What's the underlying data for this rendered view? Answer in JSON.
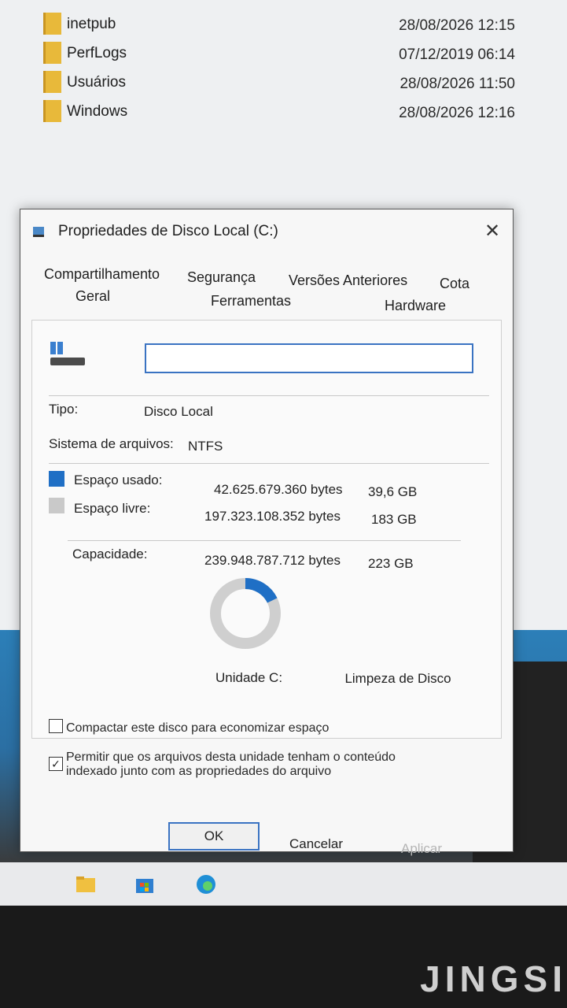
{
  "explorer": {
    "rows": [
      {
        "name": "inetpub",
        "date": "28/08/2026 12:15"
      },
      {
        "name": "PerfLogs",
        "date": "07/12/2019 06:14"
      },
      {
        "name": "Usuários",
        "date": "28/08/2026 11:50"
      },
      {
        "name": "Windows",
        "date": "28/08/2026 12:16"
      }
    ]
  },
  "dialog": {
    "title": "Propriedades de Disco Local (C:)",
    "close_glyph": "✕",
    "tabs": {
      "compartilhamento": "Compartilhamento",
      "seguranca": "Segurança",
      "versoes": "Versões Anteriores",
      "cota": "Cota",
      "geral": "Geral",
      "ferramentas": "Ferramentas",
      "hardware": "Hardware"
    },
    "volume_label_value": "",
    "tipo_label": "Tipo:",
    "tipo_value": "Disco Local",
    "fs_label": "Sistema de arquivos:",
    "fs_value": "NTFS",
    "used": {
      "label": "Espaço usado:",
      "bytes": "42.625.679.360 bytes",
      "human": "39,6 GB",
      "color": "#1f6fc5"
    },
    "free": {
      "label": "Espaço livre:",
      "bytes": "197.323.108.352 bytes",
      "human": "183 GB",
      "color": "#c9c9c9"
    },
    "capacity": {
      "label": "Capacidade:",
      "bytes": "239.948.787.712 bytes",
      "human": "223 GB"
    },
    "usage_fraction": 0.178,
    "drive_caption": "Unidade C:",
    "cleanup_button": "Limpeza de Disco",
    "compress_label": "Compactar este disco para economizar espaço",
    "index_label": "Permitir que os arquivos desta unidade tenham o conteúdo indexado junto com as propriedades do arquivo",
    "index_checked": "✓",
    "ok_button": "OK",
    "cancel_button": "Cancelar",
    "apply_button": "Aplicar"
  },
  "taskbar": {
    "icons": [
      "file-explorer-icon",
      "store-icon",
      "edge-icon"
    ]
  },
  "monitor_brand": "JINGSI"
}
